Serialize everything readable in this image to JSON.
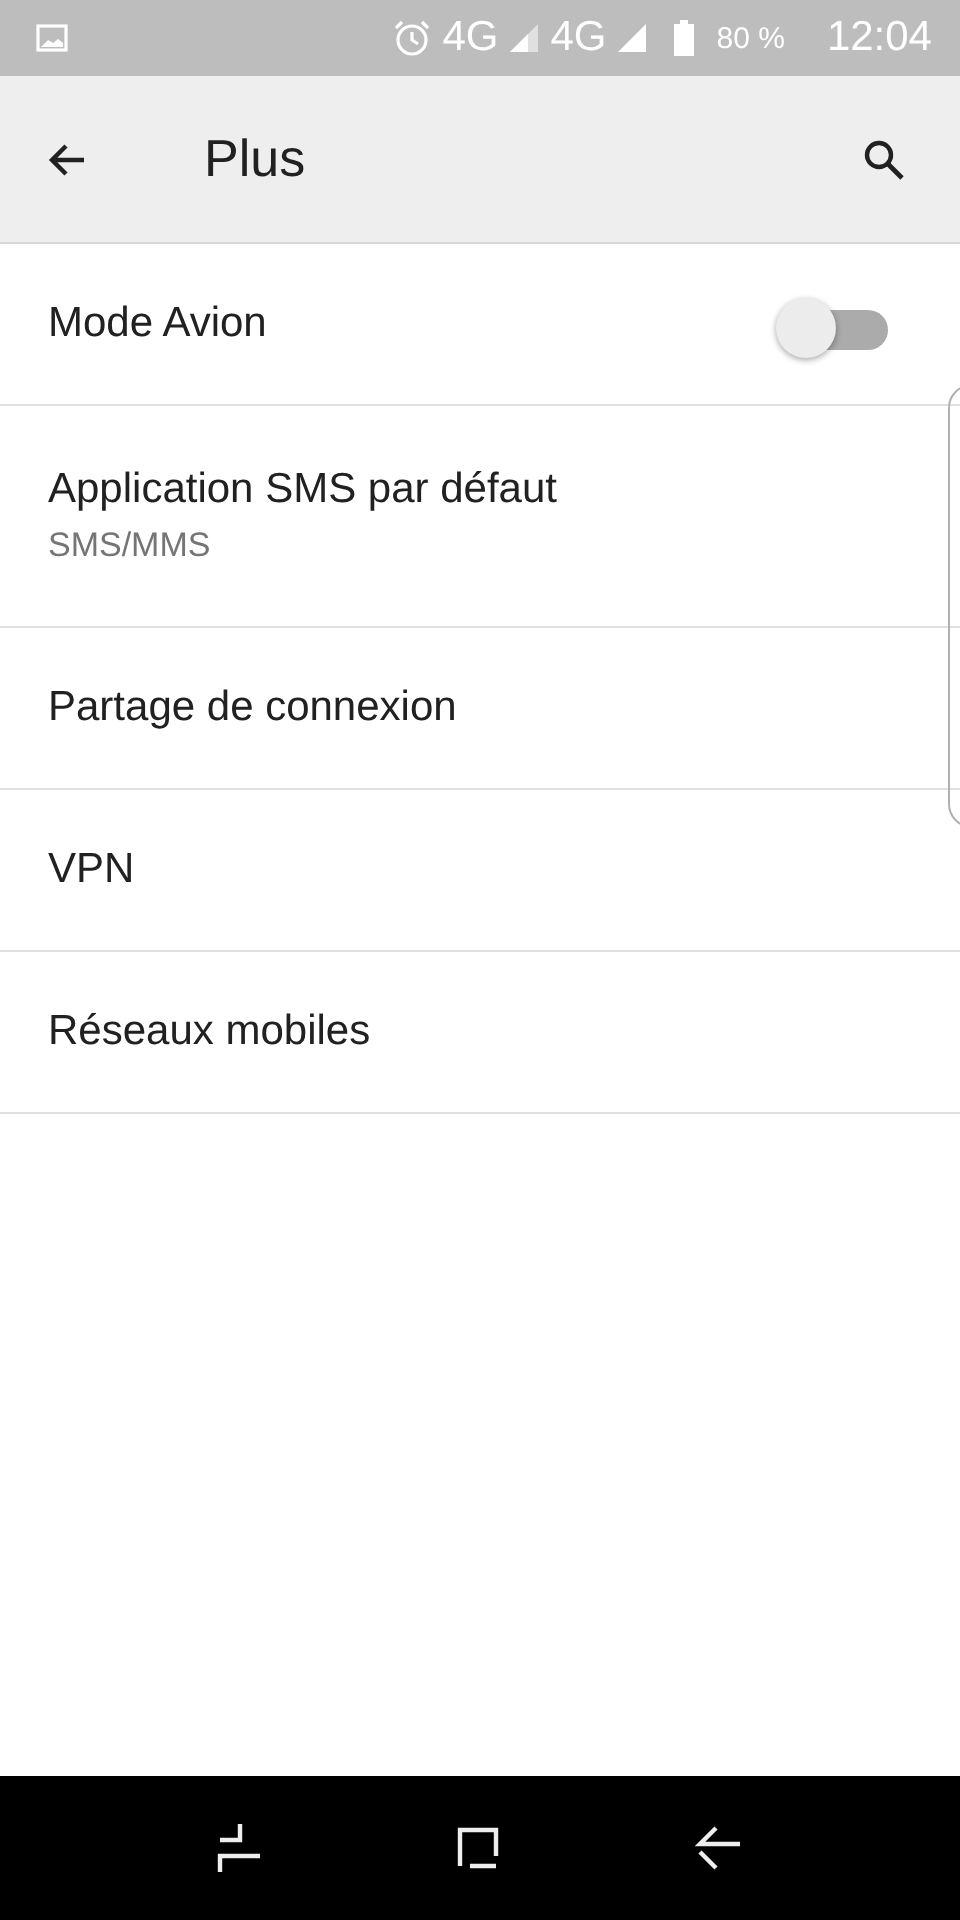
{
  "status_bar": {
    "network_1": "4G",
    "network_2": "4G",
    "battery": "80 %",
    "time": "12:04"
  },
  "app_bar": {
    "title": "Plus"
  },
  "items": [
    {
      "kind": "toggle",
      "title": "Mode Avion",
      "on": false
    },
    {
      "kind": "plain",
      "title": "Application SMS par défaut",
      "summary": "SMS/MMS"
    },
    {
      "kind": "plain",
      "title": "Partage de connexion"
    },
    {
      "kind": "plain",
      "title": "VPN"
    },
    {
      "kind": "plain",
      "title": "Réseaux mobiles"
    }
  ]
}
